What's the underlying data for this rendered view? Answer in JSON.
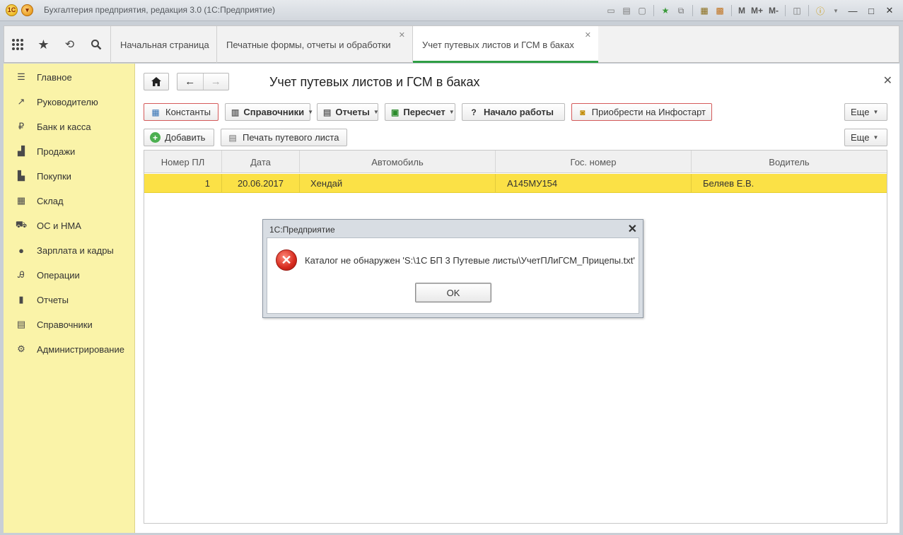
{
  "window": {
    "title": "Бухгалтерия предприятия, редакция 3.0  (1С:Предприятие)",
    "tools": [
      "M",
      "M+",
      "M-"
    ]
  },
  "tabs": [
    {
      "label": "Начальная страница"
    },
    {
      "label": "Печатные формы, отчеты и обработки"
    },
    {
      "label": "Учет путевых листов и ГСМ в баках"
    }
  ],
  "sidebar": {
    "items": [
      {
        "label": "Главное",
        "icon": "menu-icon"
      },
      {
        "label": "Руководителю",
        "icon": "trend-icon"
      },
      {
        "label": "Банк и касса",
        "icon": "ruble-icon"
      },
      {
        "label": "Продажи",
        "icon": "bag-icon"
      },
      {
        "label": "Покупки",
        "icon": "cart-icon"
      },
      {
        "label": "Склад",
        "icon": "warehouse-icon"
      },
      {
        "label": "ОС и НМА",
        "icon": "truck-icon"
      },
      {
        "label": "Зарплата и кадры",
        "icon": "person-icon"
      },
      {
        "label": "Операции",
        "icon": "operations-icon"
      },
      {
        "label": "Отчеты",
        "icon": "bar-chart-icon"
      },
      {
        "label": "Справочники",
        "icon": "books-icon"
      },
      {
        "label": "Администрирование",
        "icon": "gear-icon"
      }
    ]
  },
  "page": {
    "title": "Учет путевых листов и ГСМ в баках"
  },
  "toolbar": {
    "constants": "Константы",
    "directories": "Справочники",
    "reports": "Отчеты",
    "recalc": "Пересчет",
    "start": "Начало работы",
    "buy": "Приобрести на Инфостарт",
    "more": "Еще",
    "add": "Добавить",
    "print": "Печать путевого листа",
    "more2": "Еще"
  },
  "table": {
    "columns": [
      "Номер ПЛ",
      "Дата",
      "Автомобиль",
      "Гос. номер",
      "Водитель"
    ],
    "rows": [
      {
        "num": "1",
        "date": "20.06.2017",
        "car": "Хендай",
        "plate": "А145МУ154",
        "driver": "Беляев Е.В."
      }
    ]
  },
  "dialog": {
    "title": "1С:Предприятие",
    "message": "Каталог не обнаружен 'S:\\1С БП 3 Путевые листы\\УчетПЛиГСМ_Прицепы.txt'",
    "ok": "OK"
  },
  "colors": {
    "sidebar_bg": "#faf3a8",
    "row_selected": "#fbe146",
    "active_tab_accent": "#2f9e44",
    "error_red": "#d62a1e"
  }
}
